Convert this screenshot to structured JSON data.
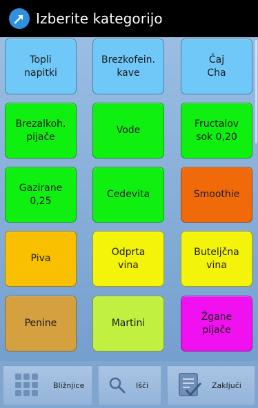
{
  "header": {
    "title": "Izberite kategorijo",
    "icon": "arrow-icon",
    "icon_color": "#2f8fe0"
  },
  "tiles": [
    {
      "label": "Topli\nnapitki",
      "color": "#6fc8f8"
    },
    {
      "label": "Brezkofein.\nkave",
      "color": "#6fc8f8"
    },
    {
      "label": "Čaj\nCha",
      "color": "#6fc8f8"
    },
    {
      "label": "Brezalkoh.\npijače",
      "color": "#10f010"
    },
    {
      "label": "Vode",
      "color": "#10f010"
    },
    {
      "label": "Fructalov\nsok 0,20",
      "color": "#10f010"
    },
    {
      "label": "Gazirane\n0,25",
      "color": "#10f010"
    },
    {
      "label": "Cedevita",
      "color": "#10f010"
    },
    {
      "label": "Smoothie",
      "color": "#f06a0a"
    },
    {
      "label": "Piva",
      "color": "#f8c000"
    },
    {
      "label": "Odprta\nvina",
      "color": "#f4f40a"
    },
    {
      "label": "Buteljčna\nvina",
      "color": "#f4f40a"
    },
    {
      "label": "Penine",
      "color": "#d4a040"
    },
    {
      "label": "Martini",
      "color": "#c2f040"
    },
    {
      "label": "Žgane\npijače",
      "color": "#f010f0"
    }
  ],
  "bottom_bar": {
    "shortcuts_label": "Bližnjice",
    "search_label": "Išči",
    "close_label": "Zaključi"
  }
}
